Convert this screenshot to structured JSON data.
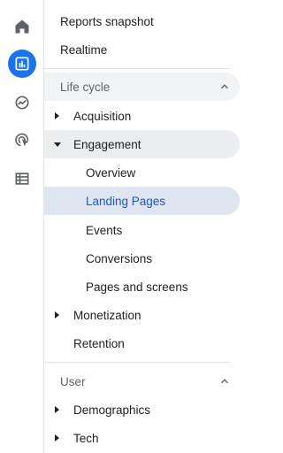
{
  "rail": {
    "icons": [
      "home-icon",
      "reports-icon",
      "explore-icon",
      "advertising-icon",
      "configure-icon"
    ],
    "accent": "#1a73e8"
  },
  "nav": {
    "reports_snapshot": "Reports snapshot",
    "realtime": "Realtime",
    "lifecycle": {
      "title": "Life cycle",
      "acquisition": "Acquisition",
      "engagement": "Engagement",
      "engagement_items": {
        "overview": "Overview",
        "landing_pages": "Landing Pages",
        "events": "Events",
        "conversions": "Conversions",
        "pages_and_screens": "Pages and screens"
      },
      "monetization": "Monetization",
      "retention": "Retention"
    },
    "user": {
      "title": "User",
      "demographics": "Demographics",
      "tech": "Tech"
    }
  },
  "colors": {
    "selected_bg": "#e0e6f1",
    "selected_text": "#1a56c4"
  }
}
